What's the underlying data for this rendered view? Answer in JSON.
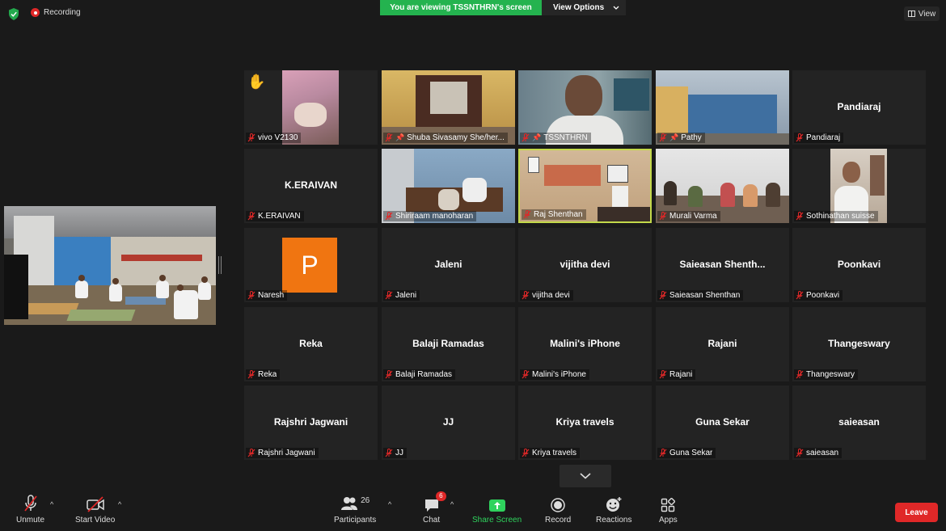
{
  "top": {
    "recording": "Recording",
    "viewing_banner": "You are viewing TSSNTHRN's screen",
    "view_options": "View Options",
    "view": "View"
  },
  "colors": {
    "banner_green": "#24b34f",
    "leave_red": "#e02828",
    "active_speaker": "#c3d94a",
    "avatar_orange": "#f07511"
  },
  "tiles": [
    {
      "name": "vivo V2130",
      "center": "",
      "type": "video",
      "hand": "✋"
    },
    {
      "name": "Shuba Sivasamy She/her...",
      "center": "",
      "type": "video",
      "pin": true
    },
    {
      "name": "TSSNTHRN",
      "center": "",
      "type": "video",
      "pin": true
    },
    {
      "name": "Pathy",
      "center": "",
      "type": "video",
      "pin": true
    },
    {
      "name": "Pandiaraj",
      "center": "Pandiaraj",
      "type": "name"
    },
    {
      "name": "K.ERAIVAN",
      "center": "K.ERAIVAN",
      "type": "name"
    },
    {
      "name": "Shiriraam manoharan",
      "center": "",
      "type": "video"
    },
    {
      "name": "Raj Shenthan",
      "center": "",
      "type": "video",
      "active": true
    },
    {
      "name": "Murali Varma",
      "center": "",
      "type": "video"
    },
    {
      "name": "Sothinathan suisse",
      "center": "",
      "type": "video"
    },
    {
      "name": "Naresh",
      "center": "",
      "type": "avatar",
      "avatar": "P"
    },
    {
      "name": "Jaleni",
      "center": "Jaleni",
      "type": "name"
    },
    {
      "name": "vijitha devi",
      "center": "vijitha devi",
      "type": "name"
    },
    {
      "name": "Saieasan Shenthan",
      "center": "Saieasan  Shenth...",
      "type": "name"
    },
    {
      "name": "Poonkavi",
      "center": "Poonkavi",
      "type": "name"
    },
    {
      "name": "Reka",
      "center": "Reka",
      "type": "name"
    },
    {
      "name": "Balaji Ramadas",
      "center": "Balaji Ramadas",
      "type": "name"
    },
    {
      "name": "Malini's iPhone",
      "center": "Malini's iPhone",
      "type": "name"
    },
    {
      "name": "Rajani",
      "center": "Rajani",
      "type": "name"
    },
    {
      "name": "Thangeswary",
      "center": "Thangeswary",
      "type": "name"
    },
    {
      "name": "Rajshri Jagwani",
      "center": "Rajshri Jagwani",
      "type": "name"
    },
    {
      "name": "JJ",
      "center": "JJ",
      "type": "name"
    },
    {
      "name": "Kriya travels",
      "center": "Kriya travels",
      "type": "name"
    },
    {
      "name": "Guna Sekar",
      "center": "Guna Sekar",
      "type": "name"
    },
    {
      "name": "saieasan",
      "center": "saieasan",
      "type": "name"
    }
  ],
  "toolbar": {
    "unmute": "Unmute",
    "start_video": "Start Video",
    "participants": "Participants",
    "participants_count": "26",
    "chat": "Chat",
    "chat_badge": "6",
    "share_screen": "Share Screen",
    "record": "Record",
    "reactions": "Reactions",
    "apps": "Apps",
    "leave": "Leave"
  }
}
